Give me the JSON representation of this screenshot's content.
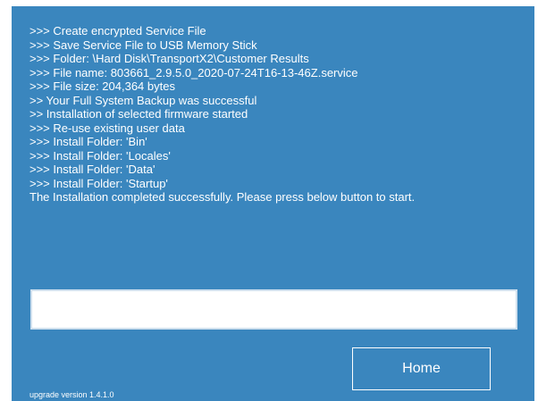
{
  "log": {
    "lines": [
      ">>> Create encrypted Service File",
      ">>> Save Service File to USB Memory Stick",
      ">>> Folder: \\Hard Disk\\TransportX2\\Customer Results",
      ">>> File name: 803661_2.9.5.0_2020-07-24T16-13-46Z.service",
      ">>> File size: 204,364 bytes",
      ">> Your Full System Backup was successful",
      ">> Installation of selected firmware started",
      ">>> Re-use existing user data",
      ">>> Install Folder: 'Bin'",
      ">>> Install Folder: 'Locales'",
      ">>> Install Folder: 'Data'",
      ">>> Install Folder: 'Startup'",
      "The Installation completed successfully. Please press below button to start."
    ]
  },
  "progress": {
    "fraction": 0
  },
  "home_button": {
    "label": "Home"
  },
  "footer": {
    "version": "upgrade version 1.4.1.0"
  },
  "colors": {
    "panel": "#3a86be",
    "text": "#ffffff"
  }
}
